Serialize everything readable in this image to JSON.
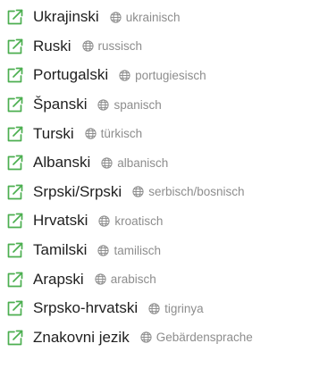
{
  "colors": {
    "icon_green": "#4caf50",
    "label_text": "#1f1f1f",
    "secondary_text": "#8d8d8d"
  },
  "icons": {
    "link": "external-link-icon",
    "language": "globe-icon"
  },
  "languages": [
    {
      "name": "Ukrajinski",
      "native": "ukrainisch"
    },
    {
      "name": "Ruski",
      "native": "russisch"
    },
    {
      "name": "Portugalski",
      "native": "portugiesisch"
    },
    {
      "name": "Španski",
      "native": "spanisch"
    },
    {
      "name": "Turski",
      "native": "türkisch"
    },
    {
      "name": "Albanski",
      "native": "albanisch"
    },
    {
      "name": "Srpski/Srpski",
      "native": "serbisch/bosnisch"
    },
    {
      "name": "Hrvatski",
      "native": "kroatisch"
    },
    {
      "name": "Tamilski",
      "native": "tamilisch"
    },
    {
      "name": "Arapski",
      "native": "arabisch"
    },
    {
      "name": "Srpsko-hrvatski",
      "native": "tigrinya"
    },
    {
      "name": "Znakovni jezik",
      "native": "Gebärdensprache"
    }
  ]
}
